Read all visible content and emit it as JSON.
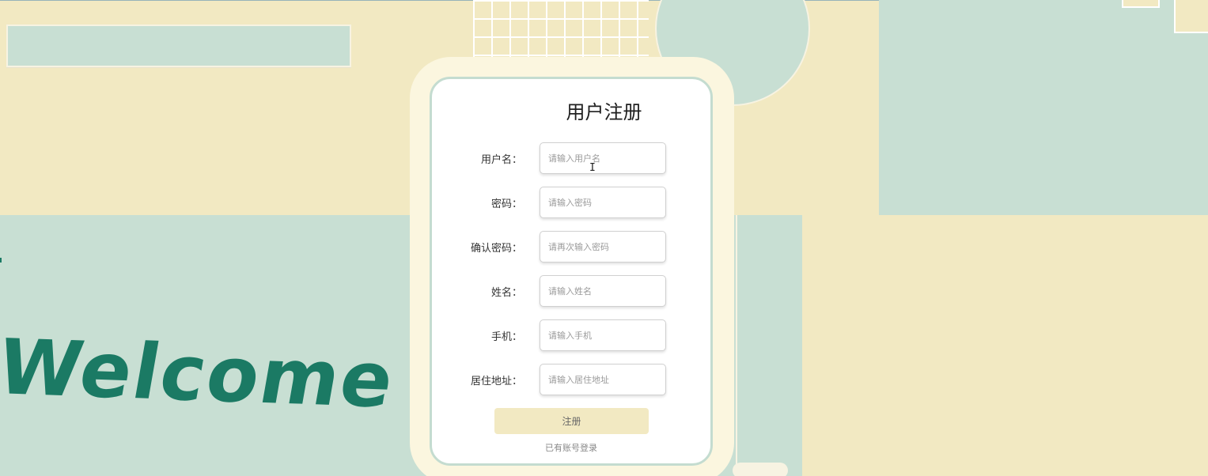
{
  "background": {
    "welcome_text": "Welcome",
    "colors": {
      "cream": "#f2e9c2",
      "mint": "#c8dfd3",
      "welcome_green": "#1b7a64"
    }
  },
  "register_form": {
    "title": "用户注册",
    "fields": [
      {
        "label": "用户名：",
        "placeholder": "请输入用户名",
        "value": ""
      },
      {
        "label": "密码：",
        "placeholder": "请输入密码",
        "value": ""
      },
      {
        "label": "确认密码：",
        "placeholder": "请再次输入密码",
        "value": ""
      },
      {
        "label": "姓名：",
        "placeholder": "请输入姓名",
        "value": ""
      },
      {
        "label": "手机：",
        "placeholder": "请输入手机",
        "value": ""
      },
      {
        "label": "居住地址：",
        "placeholder": "请输入居住地址",
        "value": ""
      }
    ],
    "submit_label": "注册",
    "login_link_label": "已有账号登录",
    "colors": {
      "button_bg": "#f2e9c2",
      "card_border": "#c4dcd0"
    }
  }
}
